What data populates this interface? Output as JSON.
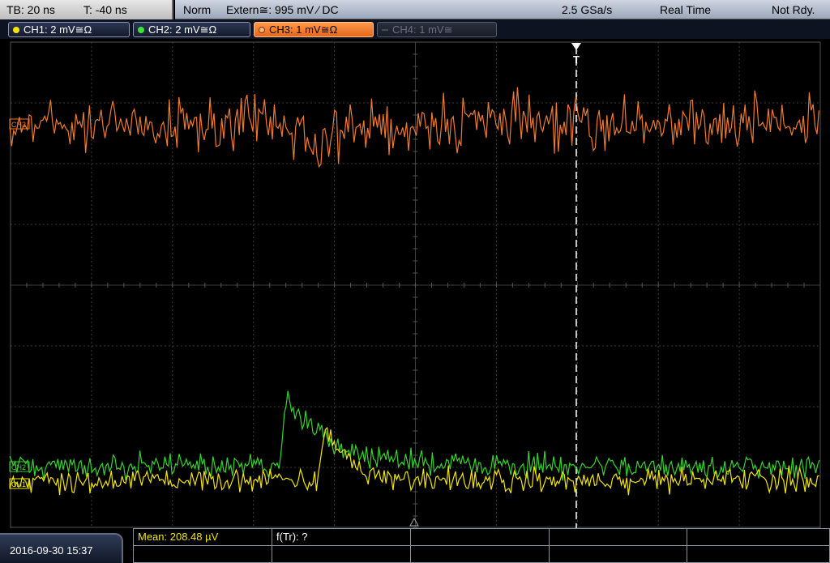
{
  "topbar": {
    "timebase": "TB: 20 ns",
    "trigger_offset": "T: -40 ns",
    "mode": "Norm",
    "trigger_source": "Extern≅: 995 mV ⁄ DC",
    "sample_rate": "2.5 GSa/s",
    "acq_mode": "Real Time",
    "status": "Not Rdy."
  },
  "channels": [
    {
      "label": "CH1: 2 mV≅Ω",
      "color": "#f2e600",
      "state": "on"
    },
    {
      "label": "CH2: 2 mV≅Ω",
      "color": "#3ee03e",
      "state": "on"
    },
    {
      "label": "CH3: 1 mV≅Ω",
      "color": "#ff7a1a",
      "state": "active"
    },
    {
      "label": "CH4: 1 mV≅",
      "color": "#6b7080",
      "state": "off"
    }
  ],
  "markers": {
    "ch3": "CH3",
    "ch2": "CH2",
    "ch1": "CH1",
    "trigger": "T"
  },
  "colors": {
    "ch1": "#f2e600",
    "ch2": "#35d42e",
    "ch3": "#f07a2c",
    "grid": "#3c3c3c",
    "trigger_line": "#ffffff"
  },
  "bottombar": {
    "datetime": "2016-09-30 15:37",
    "meas_mean": "Mean: 208.48 µV",
    "meas_freq": "f(Tr): ?"
  }
}
